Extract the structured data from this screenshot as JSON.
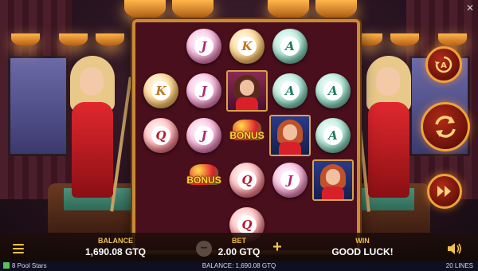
{
  "game": {
    "title": "8 Pool Stars"
  },
  "reels": {
    "columns": [
      [
        "K",
        "Q"
      ],
      [
        "J",
        "J",
        "J",
        "BONUS"
      ],
      [
        "K",
        "portrait-brunette",
        "BONUS",
        "Q",
        "Q"
      ],
      [
        "A",
        "A",
        "portrait-redhead",
        "J"
      ],
      [
        "A",
        "A",
        "portrait-redhead"
      ]
    ],
    "column_offsets": [
      "mid",
      "full",
      "full",
      "full",
      "mid"
    ],
    "bonus_label": "BONUS",
    "symbol_letters": {
      "A": "A",
      "J": "J",
      "K": "K",
      "Q": "Q"
    }
  },
  "hud": {
    "balance_label": "BALANCE",
    "balance_value": "1,690.08 GTQ",
    "bet_label": "BET",
    "bet_value": "2.00 GTQ",
    "win_label": "WIN",
    "win_value": "GOOD LUCK!"
  },
  "status_bar": {
    "game_name": "8 Pool Stars",
    "balance_text": "BALANCE: 1,690.08 GTQ",
    "lines_text": "20 LINES"
  },
  "icons": {
    "autoplay": "autoplay-icon",
    "spin": "spin-icon",
    "turbo": "fast-forward-icon",
    "menu": "menu-icon",
    "sound": "sound-icon",
    "close": "close-icon"
  },
  "colors": {
    "accent_gold": "#f2c14a",
    "frame_gold": "#c88a38",
    "reel_bg": "#4a0f1c",
    "button_red": "#b32a18"
  }
}
